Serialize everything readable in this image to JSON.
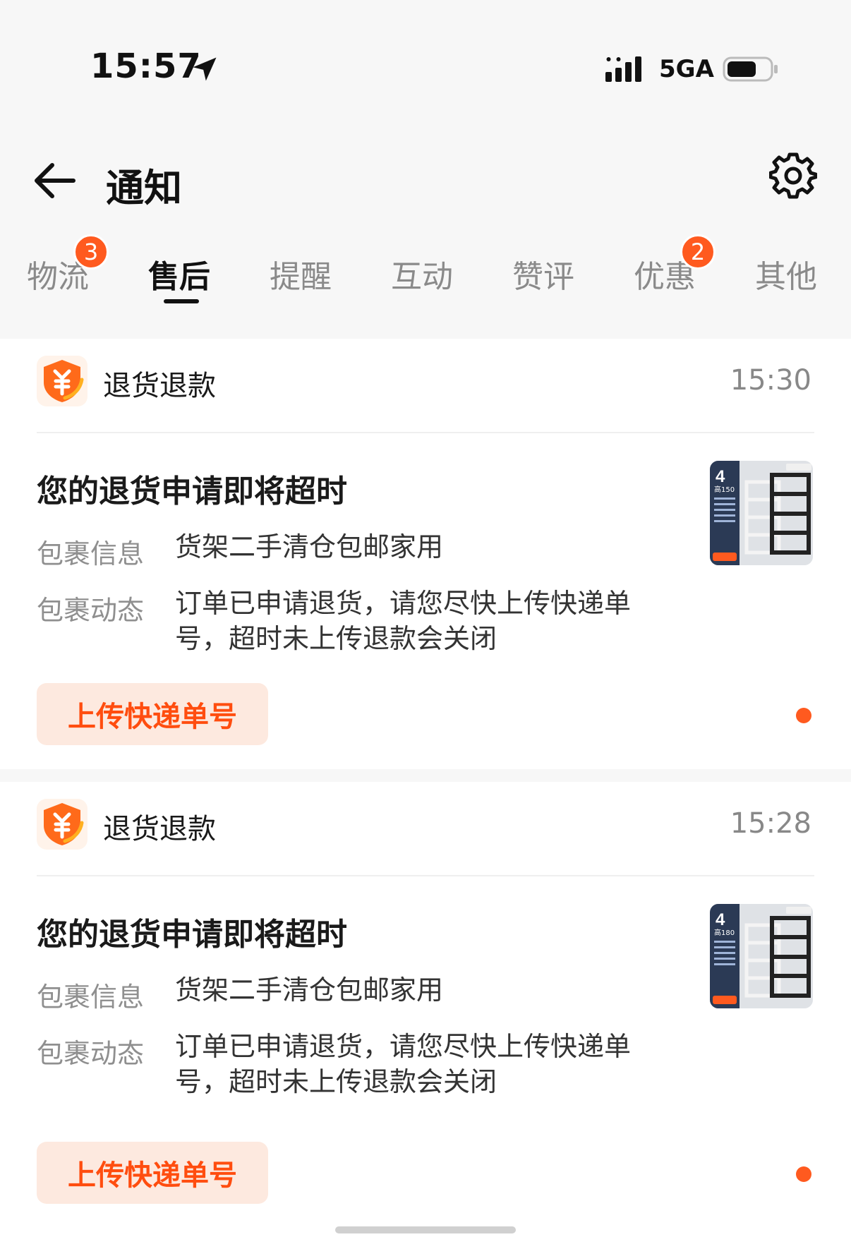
{
  "status_bar": {
    "time": "15:57",
    "network": "5GA"
  },
  "header": {
    "title": "通知"
  },
  "tabs": [
    {
      "label": "物流",
      "badge": "3"
    },
    {
      "label": "售后",
      "active": true
    },
    {
      "label": "提醒"
    },
    {
      "label": "互动"
    },
    {
      "label": "赞评"
    },
    {
      "label": "优惠",
      "badge": "2"
    },
    {
      "label": "其他"
    }
  ],
  "notifications": [
    {
      "category": "退货退款",
      "time": "15:30",
      "title": "您的退货申请即将超时",
      "info_label": "包裹信息",
      "info_value": "货架二手清仓包邮家用",
      "status_label": "包裹动态",
      "status_value": "订单已申请退货，请您尽快上传快递单号，超时未上传退款会关闭",
      "action": "上传快递单号",
      "thumb_count": "4",
      "thumb_height": "高150"
    },
    {
      "category": "退货退款",
      "time": "15:28",
      "title": "您的退货申请即将超时",
      "info_label": "包裹信息",
      "info_value": "货架二手清仓包邮家用",
      "status_label": "包裹动态",
      "status_value": "订单已申请退货，请您尽快上传快递单号，超时未上传退款会关闭",
      "action": "上传快递单号",
      "thumb_count": "4",
      "thumb_height": "高180"
    }
  ],
  "colors": {
    "accent": "#ff5a1f",
    "button_bg": "#fde9df"
  }
}
